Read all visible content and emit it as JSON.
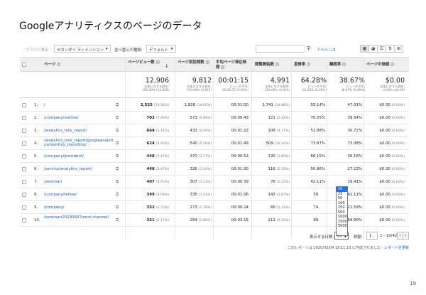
{
  "slide": {
    "title": "Googleアナリティクスのページのデータ",
    "page_number": "19"
  },
  "toolbar": {
    "graph_label": "グラフに表示",
    "secondary_dimension": "セカンダリ ディメンション",
    "sort_type_label": "並べ替えの種類:",
    "sort_type_value": "デフォルト",
    "search_value": "",
    "advanced_label": "アドバンス"
  },
  "columns": {
    "page": "ページ",
    "pageviews": "ページビュー数",
    "unique_pageviews": "ページ別訪問数",
    "avg_time": "平均ページ滞在時間",
    "entrances": "閲覧開始数",
    "bounce_rate": "直帰率",
    "exit_rate": "離脱率",
    "page_value": "ページの価値"
  },
  "totals": {
    "pageviews": {
      "value": "12,906",
      "line1": "全体に対する割合:",
      "line2": "100.00% (12,906)"
    },
    "unique_pageviews": {
      "value": "9,812",
      "line1": "全体に対する割合:",
      "line2": "100.00% (9,812)"
    },
    "avg_time": {
      "value": "00:01:15",
      "line1": "ビューの平均:",
      "line2": "00:01:15 (0.00%)"
    },
    "entrances": {
      "value": "4,991",
      "line1": "全体に対する割合:",
      "line2": "100.00% (4,991)"
    },
    "bounce_rate": {
      "value": "64.28%",
      "line1": "ビューの平均:",
      "line2": "64.28% (0.00%)"
    },
    "exit_rate": {
      "value": "38.67%",
      "line1": "ビューの平均:",
      "line2": "38.67% (0.00%)"
    },
    "page_value": {
      "value": "$0.00",
      "line1": "全体に対する割合:",
      "line2": "0.00% ($0.00)"
    }
  },
  "rows": [
    {
      "idx": "1.",
      "page": "/",
      "pv": "2,525",
      "pv_pct": "(19.56%)",
      "upv": "1,928",
      "upv_pct": "(19.65%)",
      "time": "00:01:00",
      "ent": "1,741",
      "ent_pct": "(34.88%)",
      "bounce": "55.14%",
      "exit": "47.01%",
      "val": "$0.00",
      "val_pct": "(0.00%)"
    },
    {
      "idx": "2.",
      "page": "/company/outline/",
      "pv": "703",
      "pv_pct": "(5.45%)",
      "upv": "573",
      "upv_pct": "(5.84%)",
      "time": "00:00:43",
      "ent": "121",
      "ent_pct": "(2.42%)",
      "bounce": "70.25%",
      "exit": "39.54%",
      "val": "$0.00",
      "val_pct": "(0.00%)"
    },
    {
      "idx": "3.",
      "page": "/analytics_mils_report/",
      "pv": "664",
      "pv_pct": "(5.14%)",
      "upv": "431",
      "upv_pct": "(4.39%)",
      "time": "00:01:22",
      "ent": "208",
      "ent_pct": "(4.17%)",
      "bounce": "52.88%",
      "exit": "30.72%",
      "val": "$0.00",
      "val_pct": "(0.00%)"
    },
    {
      "idx": "4.",
      "page": "/analytics_mils_report/googleanalytics/monthly_transition/",
      "pv": "624",
      "pv_pct": "(4.83%)",
      "upv": "540",
      "upv_pct": "(5.50%)",
      "time": "00:01:49",
      "ent": "509",
      "ent_pct": "(10.20%)",
      "bounce": "73.87%",
      "exit": "73.08%",
      "val": "$0.00",
      "val_pct": "(0.00%)"
    },
    {
      "idx": "5.",
      "page": "/company/president/",
      "pv": "448",
      "pv_pct": "(3.47%)",
      "upv": "370",
      "upv_pct": "(3.77%)",
      "time": "00:00:52",
      "ent": "130",
      "ent_pct": "(2.60%)",
      "bounce": "66.15%",
      "exit": "36.16%",
      "val": "$0.00",
      "val_pct": "(0.00%)"
    },
    {
      "idx": "6.",
      "page": "/service/analytics_report/",
      "pv": "448",
      "pv_pct": "(3.47%)",
      "upv": "326",
      "upv_pct": "(3.32%)",
      "time": "00:01:30",
      "ent": "116",
      "ent_pct": "(2.32%)",
      "bounce": "50.86%",
      "exit": "27.23%",
      "val": "$0.00",
      "val_pct": "(0.00%)"
    },
    {
      "idx": "7.",
      "page": "/seminar/",
      "pv": "407",
      "pv_pct": "(3.15%)",
      "upv": "307",
      "upv_pct": "(3.13%)",
      "time": "00:00:39",
      "ent": "76",
      "ent_pct": "(1.52%)",
      "bounce": "42.11%",
      "exit": "19.41%",
      "val": "$0.00",
      "val_pct": "(0.00%)"
    },
    {
      "idx": "8.",
      "page": "/company/fellow/",
      "pv": "399",
      "pv_pct": "(3.09%)",
      "upv": "335",
      "upv_pct": "(3.41%)",
      "time": "00:01:06",
      "ent": "143",
      "ent_pct": "(2.87%)",
      "bounce": "58.",
      "exit": "42.11%",
      "val": "$0.00",
      "val_pct": "(0.00%)"
    },
    {
      "idx": "9.",
      "page": "/company/",
      "pv": "352",
      "pv_pct": "(2.73%)",
      "upv": "273",
      "upv_pct": "(2.78%)",
      "time": "00:00:24",
      "ent": "66",
      "ent_pct": "(1.32%)",
      "bounce": "74.",
      "exit": "21.59%",
      "val": "$0.00",
      "val_pct": "(0.00%)"
    },
    {
      "idx": "10.",
      "page": "/seminar/20190607omni-channel/",
      "pv": "351",
      "pv_pct": "(2.72%)",
      "upv": "284",
      "upv_pct": "(2.89%)",
      "time": "00:03:15",
      "ent": "212",
      "ent_pct": "(4.25%)",
      "bounce": "89.",
      "exit": "69.80%",
      "val": "$0.00",
      "val_pct": "(0.00%)"
    }
  ],
  "rows_dropdown": {
    "options": [
      "10",
      "25",
      "50",
      "100",
      "250",
      "500",
      "1000",
      "2500",
      "5000"
    ],
    "selected": "10"
  },
  "pagination": {
    "rows_label": "表示する行数:",
    "rows_value": "10",
    "goto_label": "移動:",
    "goto_value": "1",
    "range": "1 - 10/425"
  },
  "footer": {
    "note": "このレポートは 2020/03/04 18:11:13 に作成されました - ",
    "refresh_link": "レポートを更新"
  },
  "icons": [
    "search-icon",
    "sort-desc-icon",
    "info-icon",
    "external-link-icon",
    "table-view-icon",
    "pie-view-icon",
    "performance-view-icon",
    "comparison-view-icon",
    "pivot-view-icon",
    "prev-page-icon",
    "next-page-icon"
  ],
  "colors": {
    "link": "#1a57c6",
    "header_bg": "#efefef",
    "dropdown_selected": "#1e73e8"
  }
}
